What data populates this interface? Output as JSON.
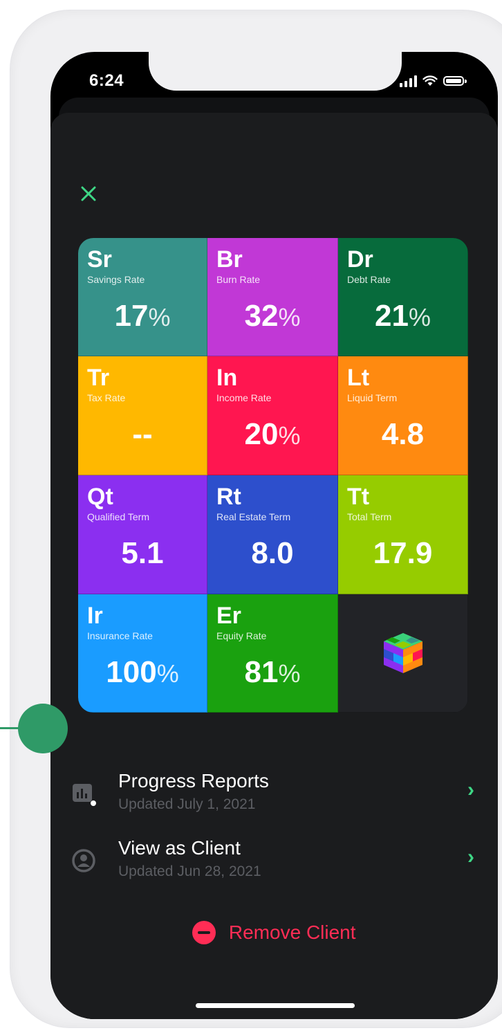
{
  "status_bar": {
    "time": "6:24"
  },
  "header": {
    "close_icon": "close-x-icon",
    "accent": "#3ed685"
  },
  "metrics": [
    {
      "sym": "Sr",
      "label": "Savings Rate",
      "value": "17",
      "unit": "%",
      "color": "#36928a"
    },
    {
      "sym": "Br",
      "label": "Burn Rate",
      "value": "32",
      "unit": "%",
      "color": "#c138d6"
    },
    {
      "sym": "Dr",
      "label": "Debt Rate",
      "value": "21",
      "unit": "%",
      "color": "#076b3c"
    },
    {
      "sym": "Tr",
      "label": "Tax Rate",
      "value": "--",
      "unit": "",
      "color": "#ffb800"
    },
    {
      "sym": "In",
      "label": "Income Rate",
      "value": "20",
      "unit": "%",
      "color": "#ff1650"
    },
    {
      "sym": "Lt",
      "label": "Liquid Term",
      "value": "4.8",
      "unit": "",
      "color": "#ff8a10"
    },
    {
      "sym": "Qt",
      "label": "Qualified Term",
      "value": "5.1",
      "unit": "",
      "color": "#8b2ff0"
    },
    {
      "sym": "Rt",
      "label": "Real Estate Term",
      "value": "8.0",
      "unit": "",
      "color": "#2d4fcc"
    },
    {
      "sym": "Tt",
      "label": "Total Term",
      "value": "17.9",
      "unit": "",
      "color": "#96cc00"
    },
    {
      "sym": "Ir",
      "label": "Insurance Rate",
      "value": "100",
      "unit": "%",
      "color": "#1a9cff"
    },
    {
      "sym": "Er",
      "label": "Equity Rate",
      "value": "81",
      "unit": "%",
      "color": "#1aa10f"
    }
  ],
  "logo": {
    "icon": "cube-logo-icon"
  },
  "menu": [
    {
      "title": "Progress Reports",
      "subtitle": "Updated July 1, 2021",
      "icon": "bar-chart-icon"
    },
    {
      "title": "View as Client",
      "subtitle": "Updated Jun 28, 2021",
      "icon": "user-circle-icon"
    }
  ],
  "remove": {
    "label": "Remove Client",
    "color": "#ff2d55"
  }
}
